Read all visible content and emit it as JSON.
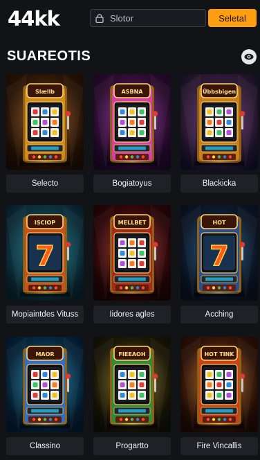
{
  "header": {
    "logo": "44kk",
    "search_placeholder": "Slotor",
    "signup_label": "Seletal"
  },
  "section": {
    "title": "SUAREOTIS"
  },
  "games": [
    {
      "label": "Selecto",
      "marquee": "Slællb",
      "theme": "gold",
      "accent": "#d08a1a",
      "glow": "#b7772a"
    },
    {
      "label": "Bogiatoyus",
      "marquee": "ASBNA",
      "theme": "pink",
      "accent": "#d63fa8",
      "glow": "#b03ad6"
    },
    {
      "label": "Blackicka",
      "marquee": "Übbsbigen",
      "theme": "stage",
      "accent": "#c97e19",
      "glow": "#8c3aa8"
    },
    {
      "label": "Mopiaintdes Vituss",
      "marquee": "ISCIOP",
      "theme": "teal",
      "accent": "#c7531b",
      "glow": "#18a0b8"
    },
    {
      "label": "Iidores agles",
      "marquee": "MELLBET",
      "theme": "red",
      "accent": "#a32a1d",
      "glow": "#d1433a"
    },
    {
      "label": "Acching",
      "marquee": "HOT",
      "theme": "blue",
      "accent": "#2a4f8a",
      "glow": "#1f6fb0"
    },
    {
      "label": "Classino",
      "marquee": "MAOR",
      "theme": "cyan",
      "accent": "#2f6fc7",
      "glow": "#21b7d8"
    },
    {
      "label": "Progartto",
      "marquee": "FIEEAOH",
      "theme": "green",
      "accent": "#2f8a3a",
      "glow": "#c9a52a"
    },
    {
      "label": "Fire Vincallis",
      "marquee": "HOT TINK",
      "theme": "fire",
      "accent": "#c9401a",
      "glow": "#e8962a"
    }
  ]
}
